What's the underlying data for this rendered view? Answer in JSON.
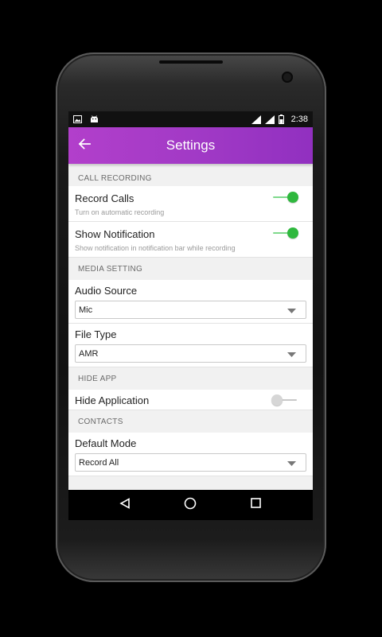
{
  "status_bar": {
    "time": "2:38",
    "icons": [
      "image-icon",
      "android-icon",
      "signal-icon",
      "signal-icon",
      "battery-icon"
    ]
  },
  "app_bar": {
    "title": "Settings",
    "back_icon": "arrow-back-icon",
    "accent_color": "#a23ac6"
  },
  "sections": {
    "call_recording": {
      "header": "CALL RECORDING",
      "record_calls": {
        "title": "Record Calls",
        "summary": "Turn on automatic recording",
        "enabled": true
      },
      "show_notification": {
        "title": "Show Notification",
        "summary": "Show notification in notification bar while recording",
        "enabled": true
      }
    },
    "media_setting": {
      "header": "MEDIA SETTING",
      "audio_source": {
        "title": "Audio Source",
        "value": "Mic"
      },
      "file_type": {
        "title": "File Type",
        "value": "AMR"
      }
    },
    "hide_app": {
      "header": "HIDE APP",
      "hide_application": {
        "title": "Hide Application",
        "enabled": false
      }
    },
    "contacts": {
      "header": "CONTACTS",
      "default_mode": {
        "title": "Default Mode",
        "value": "Record All"
      }
    }
  },
  "nav_bar": {
    "icons": [
      "back-triangle-icon",
      "home-circle-icon",
      "recents-square-icon"
    ]
  },
  "colors": {
    "toggle_on": "#2fb83e",
    "toggle_off": "#d6d6d6"
  }
}
